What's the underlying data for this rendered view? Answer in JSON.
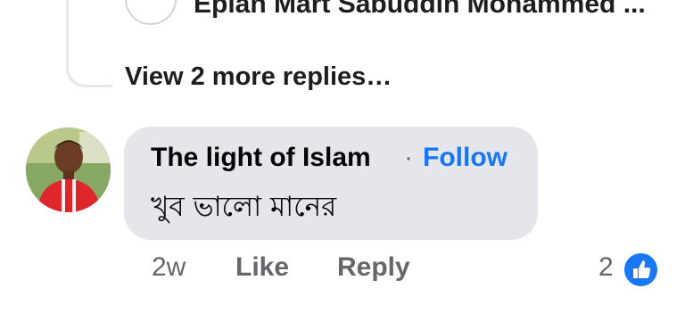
{
  "previous_reply": {
    "author_snippet": "Eplan Mart Sabuddin Mohammed ..."
  },
  "view_more": {
    "label": "View 2 more replies…"
  },
  "comment": {
    "author": "The light of Islam",
    "separator": "·",
    "follow_label": "Follow",
    "text": "খুব ভালো মানের",
    "time_ago": "2w",
    "like_label": "Like",
    "reply_label": "Reply",
    "reaction_count": "2",
    "reaction_icon": "thumbs-up-icon"
  },
  "colors": {
    "bubble": "#e4e6eb",
    "link": "#1877f2",
    "muted": "#65676b"
  }
}
